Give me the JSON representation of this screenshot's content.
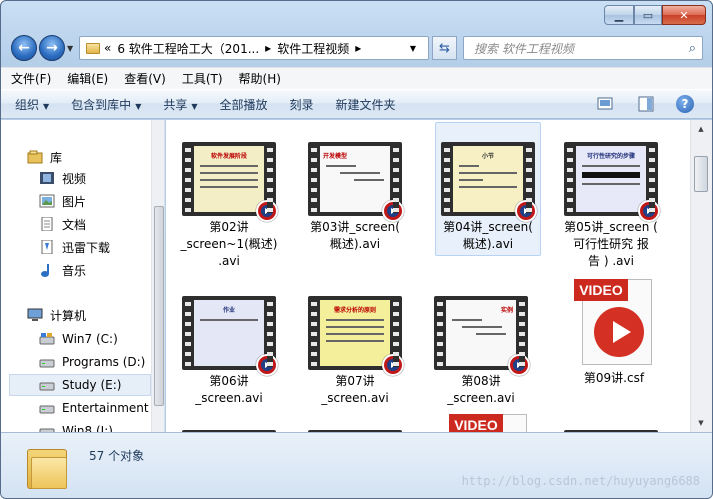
{
  "address": {
    "back_label": "«",
    "part1": "6 软件工程哈工大（201...",
    "sep": "▸",
    "part2": "软件工程视频"
  },
  "search": {
    "placeholder": "搜索 软件工程视频"
  },
  "menu": [
    "文件(F)",
    "编辑(E)",
    "查看(V)",
    "工具(T)",
    "帮助(H)"
  ],
  "toolbar": [
    "组织",
    "包含到库中",
    "共享",
    "全部播放",
    "刻录",
    "新建文件夹"
  ],
  "sidebar": {
    "libraries_header": "库",
    "libraries": [
      "视频",
      "图片",
      "文档",
      "迅雷下载",
      "音乐"
    ],
    "computer_header": "计算机",
    "drives": [
      "Win7 (C:)",
      "Programs (D:)",
      "Study (E:)",
      "Entertainment (",
      "Win8 (I:)"
    ]
  },
  "files": [
    {
      "name": "第02讲\n_screen~1(概述)\n.avi",
      "slide_title": "软件发展阶段",
      "slide_bg": "#f4eec6"
    },
    {
      "name": "第03讲_screen(\n概述).avi",
      "slide_title": "开发模型",
      "slide_bg": "#f8f8f8"
    },
    {
      "name": "第04讲_screen(\n概述).avi",
      "slide_title": "小节",
      "slide_bg": "#f6f0c4"
    },
    {
      "name": "第05讲_screen (\n可行性研究 报\n告 ) .avi",
      "slide_title": "可行性研究的步骤",
      "slide_bg": "#e7e9f8"
    },
    {
      "name": "第06讲\n_screen.avi",
      "slide_title": "作业",
      "slide_bg": "#e4e8f6"
    },
    {
      "name": "第07讲\n_screen.avi",
      "slide_title": "需求分析的原则",
      "slide_bg": "#f3ef9a"
    },
    {
      "name": "第08讲\n_screen.avi",
      "slide_title": "实例",
      "slide_bg": "#f8f8f8"
    },
    {
      "name": "第09讲.csf",
      "video_label": "VIDEO"
    }
  ],
  "next_row_video_label": "VIDEO",
  "status": {
    "count": "57 个对象"
  },
  "watermark": "http://blog.csdn.net/huyuyang6688",
  "colors": {
    "selection": "#e8f1fb",
    "play_red": "#c01818",
    "video_red": "#cc2a1e"
  }
}
